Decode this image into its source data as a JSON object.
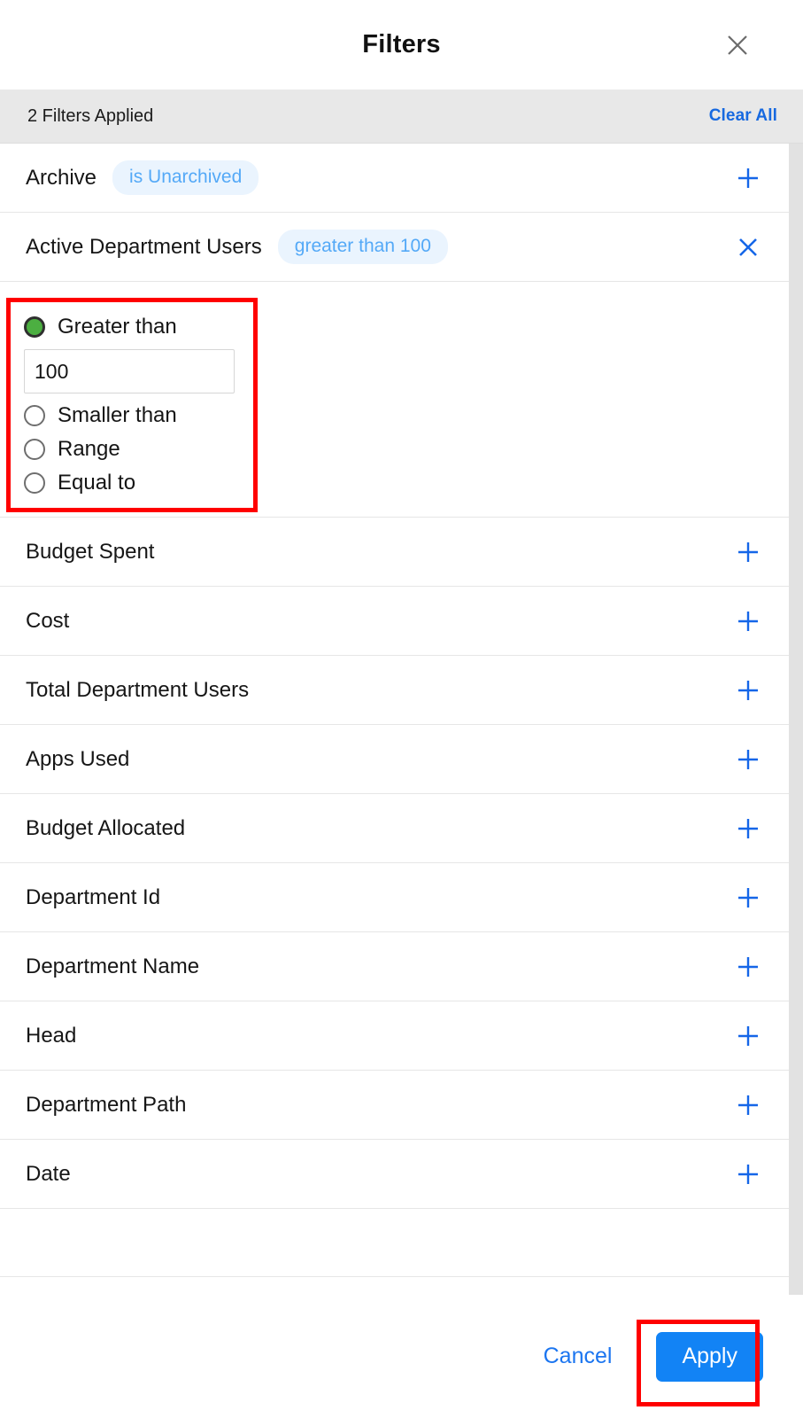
{
  "header": {
    "title": "Filters",
    "close_icon": "close-icon"
  },
  "applied_bar": {
    "count_text": "2 Filters Applied",
    "clear_all_label": "Clear All"
  },
  "applied_filters": [
    {
      "label": "Archive",
      "badge": "is Unarchived",
      "action_icon": "plus-icon",
      "expanded": false
    },
    {
      "label": "Active Department Users",
      "badge": "greater than 100",
      "action_icon": "close-icon",
      "expanded": true
    }
  ],
  "expanded_filter": {
    "options": [
      {
        "label": "Greater than",
        "selected": true
      },
      {
        "label": "Smaller than",
        "selected": false
      },
      {
        "label": "Range",
        "selected": false
      },
      {
        "label": "Equal to",
        "selected": false
      }
    ],
    "value_input": {
      "value": "100",
      "placeholder": ""
    }
  },
  "available_filters": [
    {
      "label": "Budget Spent",
      "action_icon": "plus-icon"
    },
    {
      "label": "Cost",
      "action_icon": "plus-icon"
    },
    {
      "label": "Total Department Users",
      "action_icon": "plus-icon"
    },
    {
      "label": "Apps Used",
      "action_icon": "plus-icon"
    },
    {
      "label": "Budget Allocated",
      "action_icon": "plus-icon"
    },
    {
      "label": "Department Id",
      "action_icon": "plus-icon"
    },
    {
      "label": "Department Name",
      "action_icon": "plus-icon"
    },
    {
      "label": "Head",
      "action_icon": "plus-icon"
    },
    {
      "label": "Department Path",
      "action_icon": "plus-icon"
    },
    {
      "label": "Date",
      "action_icon": "plus-icon"
    }
  ],
  "footer": {
    "cancel_label": "Cancel",
    "apply_label": "Apply"
  },
  "colors": {
    "accent_blue": "#1283f5",
    "link_blue": "#1769e0",
    "badge_bg": "#eaf4fe",
    "badge_text": "#54a9f7",
    "applied_bar_bg": "#e8e8e8",
    "annotation_red": "#ff0000",
    "selected_radio_green": "#4caf41"
  }
}
